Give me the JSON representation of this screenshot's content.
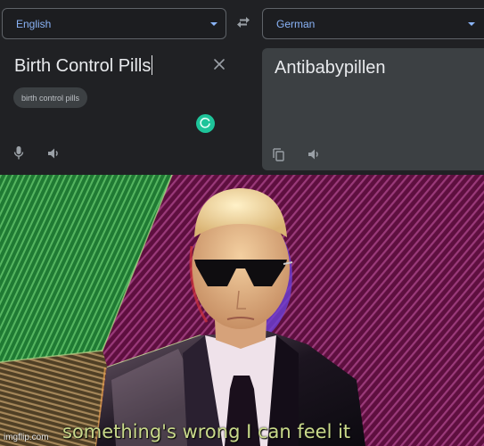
{
  "translator": {
    "source_language": "English",
    "target_language": "German",
    "source_text": "Birth Control Pills",
    "suggestion_chip": "birth control pills",
    "translated_text": "Antibabypillen",
    "icons": {
      "swap": "swap-languages-icon",
      "clear": "close-icon",
      "loading": "loading-spinner-icon",
      "mic": "microphone-icon",
      "listen_source": "speaker-icon",
      "copy": "copy-icon",
      "listen_target": "speaker-icon"
    },
    "colors": {
      "accent": "#8ab4f8",
      "background": "#202124",
      "output_panel": "#3c4043",
      "spinner": "#1ec49a"
    }
  },
  "meme": {
    "caption": "something's wrong I can feel it",
    "watermark": "imgflip.com",
    "subject": "man in black suit with sunglasses",
    "colors": {
      "green_panel": "#2e8b3e",
      "magenta_panel": "#6b1248",
      "tan_panel": "#6b5a3a",
      "caption": "#c9d98a"
    }
  }
}
